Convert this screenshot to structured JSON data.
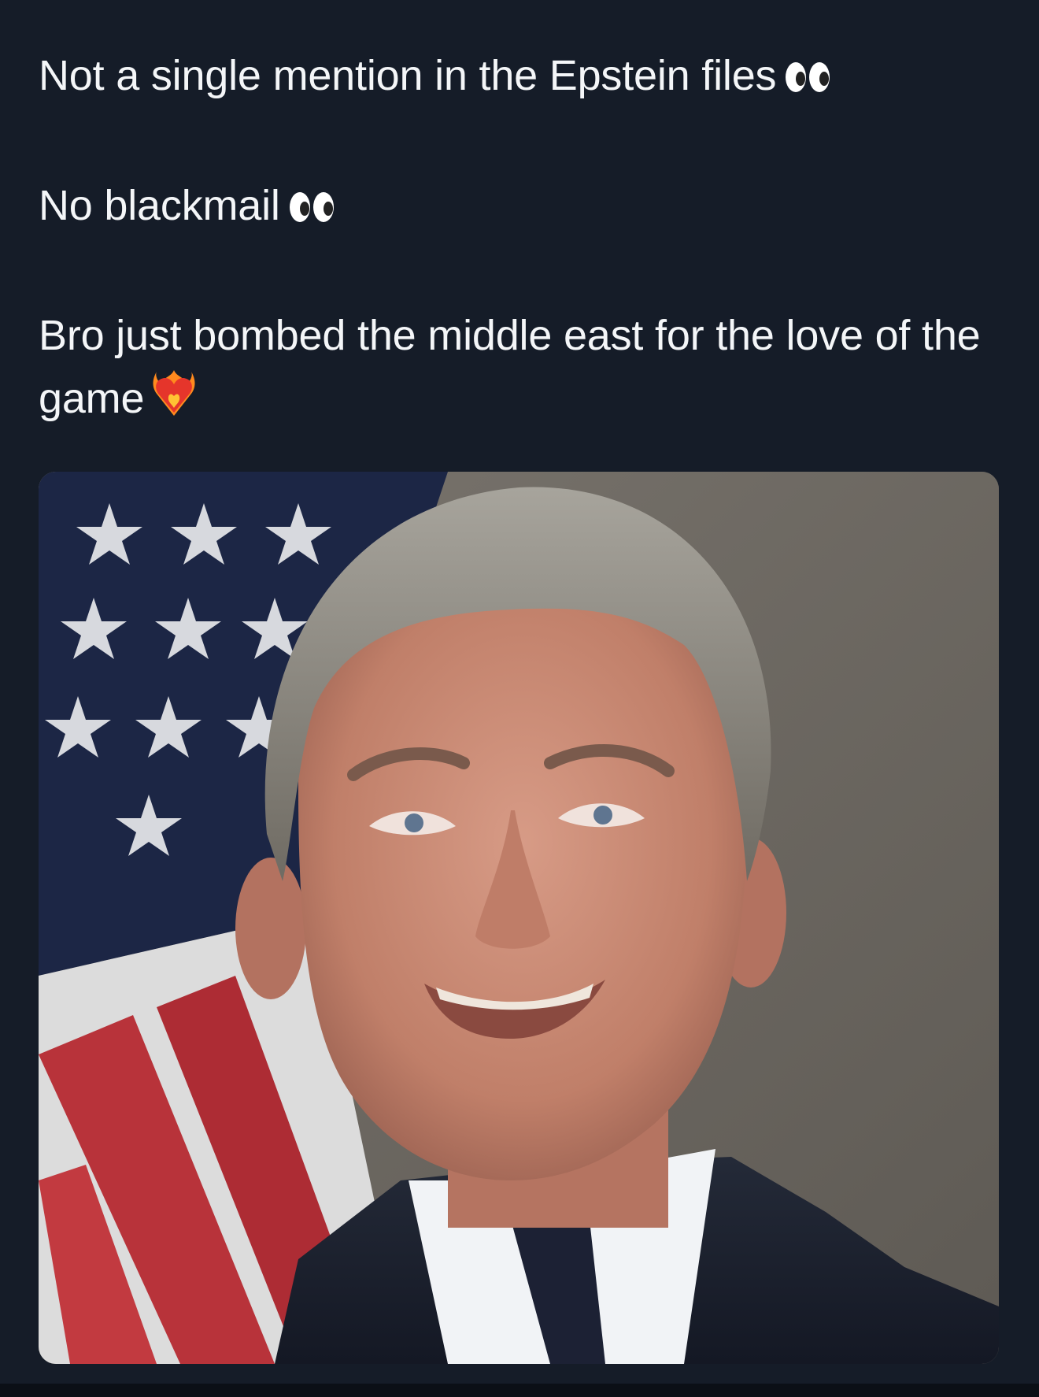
{
  "post": {
    "paragraphs": [
      {
        "text": "Not a single mention in the Epstein files",
        "emoji": "eyes-icon"
      },
      {
        "text": "No blackmail",
        "emoji": "eyes-icon"
      },
      {
        "text": "Bro just bombed the middle east for the love of the game",
        "emoji": "heart-on-fire-icon"
      }
    ],
    "image": {
      "subject": "portrait-photo",
      "background": "american-flag"
    }
  },
  "colors": {
    "background": "#151c28",
    "text": "#f4f6f8"
  }
}
